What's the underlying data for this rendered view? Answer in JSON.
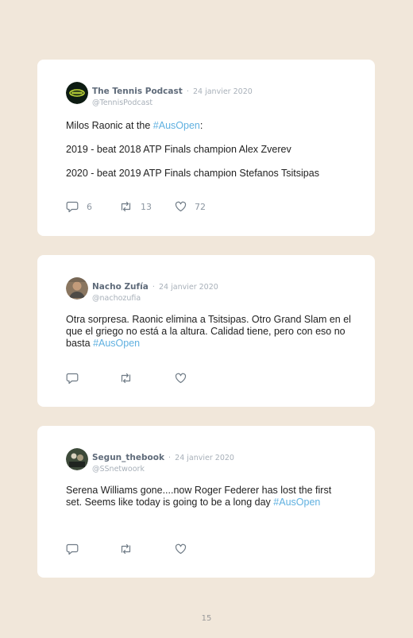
{
  "tweets": [
    {
      "name": "The Tennis Podcast",
      "separator": "·",
      "date": "24 janvier 2020",
      "handle": "@TennisPodcast",
      "lines": [
        {
          "pre": "Milos Raonic at the ",
          "tag": "#AusOpen",
          "post": ":"
        },
        {
          "pre": "2019 - beat 2018 ATP Finals champion Alex Zverev",
          "tag": "",
          "post": ""
        },
        {
          "pre": "2020 - beat 2019 ATP Finals champion Stefanos Tsitsipas",
          "tag": "",
          "post": ""
        }
      ],
      "replies": "6",
      "retweets": "13",
      "likes": "72"
    },
    {
      "name": "Nacho Zufía",
      "separator": "·",
      "date": "24 janvier 2020",
      "handle": "@nachozufia",
      "text_pre": "Otra sorpresa. Raonic elimina a Tsitsipas. Otro Grand Slam en el que el griego no está a la altura. Calidad tiene, pero con eso no basta ",
      "tag": "#AusOpen"
    },
    {
      "name": "Segun_thebook",
      "separator": "·",
      "date": "24 janvier 2020",
      "handle": "@SSnetwoork",
      "text_pre": "Serena Williams gone....now Roger Federer has lost the first set. Seems like today is going to be a long day ",
      "tag": "#AusOpen"
    }
  ],
  "page_number": "15",
  "colors": {
    "background": "#f1e7da",
    "card": "#ffffff",
    "link": "#5fb0e0",
    "name": "#5f6b7a",
    "meta": "#a8b0b9"
  },
  "icons": [
    "reply-icon",
    "retweet-icon",
    "like-icon"
  ]
}
